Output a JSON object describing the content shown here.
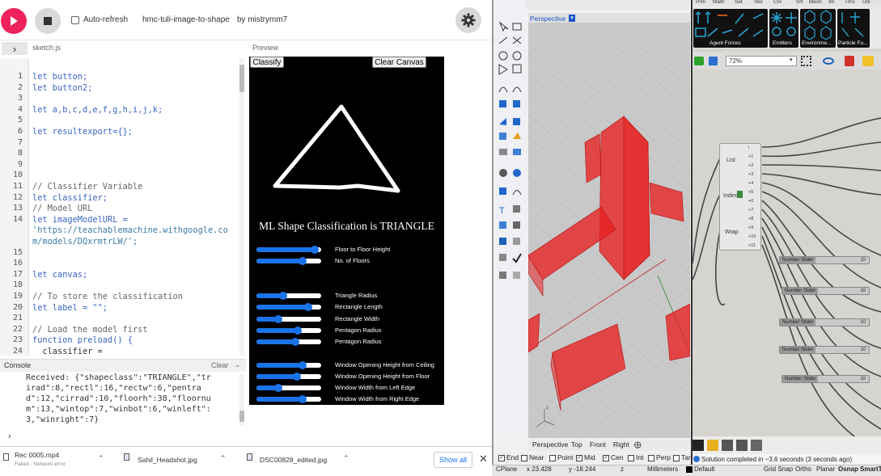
{
  "editor": {
    "auto_refresh_label": "Auto-refresh",
    "sketch_name": "hmc-tuli-image-to-shape",
    "by_label": "by mistrymm7",
    "file_name": "sketch.js",
    "preview_label": "Preview",
    "code_lines": [
      {
        "n": "1",
        "text": "let button;"
      },
      {
        "n": "2",
        "text": "let button2;"
      },
      {
        "n": "3",
        "text": ""
      },
      {
        "n": "4",
        "text": "let a,b,c,d,e,f,g,h,i,j,k;"
      },
      {
        "n": "5",
        "text": ""
      },
      {
        "n": "6",
        "text": "let resultexport={};"
      },
      {
        "n": "7",
        "text": ""
      },
      {
        "n": "8",
        "text": ""
      },
      {
        "n": "9",
        "text": ""
      },
      {
        "n": "10",
        "text": ""
      },
      {
        "n": "11",
        "text": "// Classifier Variable"
      },
      {
        "n": "12",
        "text": "let classifier;"
      },
      {
        "n": "13",
        "text": "// Model URL"
      },
      {
        "n": "14",
        "text": "let imageModelURL ="
      },
      {
        "n": "",
        "text": "'https://teachablemachine.withgoogle.co"
      },
      {
        "n": "",
        "text": "m/models/DQxrmtrLW/';"
      },
      {
        "n": "15",
        "text": ""
      },
      {
        "n": "16",
        "text": ""
      },
      {
        "n": "17",
        "text": "let canvas;"
      },
      {
        "n": "18",
        "text": ""
      },
      {
        "n": "19",
        "text": "// To store the classification"
      },
      {
        "n": "20",
        "text": "let label = \"\";"
      },
      {
        "n": "21",
        "text": ""
      },
      {
        "n": "22",
        "text": "// Load the model first"
      },
      {
        "n": "23",
        "text": "function preload() {"
      },
      {
        "n": "24",
        "text": "  classifier ="
      }
    ],
    "console_label": "Console",
    "clear_label": "Clear",
    "console_lines": [
      "Received: {\"shapeclass\":\"TRIANGLE\",\"tr",
      "irad\":8,\"rectl\":16,\"rectw\":6,\"pentra",
      "d\":12,\"cirrad\":10,\"floorh\":38,\"floornu",
      "m\":13,\"wintop\":7,\"winbot\":6,\"winleft\":",
      "3,\"winright\":7}"
    ],
    "prompt": "›"
  },
  "preview": {
    "classify_label": "Classify",
    "clear_canvas_label": "Clear Canvas",
    "result_text": "ML Shape Classification is TRIANGLE",
    "sliders": [
      {
        "label": "Floor to Floor Height",
        "value": 0.9
      },
      {
        "label": "No. of Floors",
        "value": 0.71
      },
      {
        "label": "Triangle Radius",
        "value": 0.41
      },
      {
        "label": "Rectangle Length",
        "value": 0.8
      },
      {
        "label": "Rectangle Width",
        "value": 0.34
      },
      {
        "label": "Pentagon Radius",
        "value": 0.64
      },
      {
        "label": "Pentagon Radius",
        "value": 0.6
      },
      {
        "label": "Window Opening Height from Ceiling",
        "value": 0.71
      },
      {
        "label": "Window Opening Height from Floor",
        "value": 0.63
      },
      {
        "label": "Window Width from Left Edge",
        "value": 0.34
      },
      {
        "label": "Window Width from Right Edge",
        "value": 0.71
      }
    ]
  },
  "downloads": {
    "items": [
      {
        "name": "Rec 0005.mp4",
        "sub": "Failed - Network error"
      },
      {
        "name": "Sahil_Headshot.jpg",
        "sub": ""
      },
      {
        "name": "DSC00828_edited.jpg",
        "sub": ""
      }
    ],
    "show_all": "Show all"
  },
  "rhino": {
    "viewport_title": "Perspective",
    "view_tabs": [
      "Perspective",
      "Top",
      "Front",
      "Right"
    ],
    "osnaps": [
      "End",
      "Near",
      "Point",
      "Mid",
      "Cen",
      "Int",
      "Perp",
      "Tan"
    ],
    "status": {
      "cplane": "CPlane",
      "x": "x 23.428",
      "y": "y -18.244",
      "z": "z",
      "units": "Millimeters",
      "layer": "Default",
      "toggles": [
        "Grid Snap",
        "Ortho",
        "Planar",
        "Osnap",
        "SmartT"
      ]
    }
  },
  "grasshopper": {
    "tabs": [
      "Prm",
      "Math",
      "Set",
      "Vec",
      "Crv",
      "Srf",
      "Mesh",
      "Int",
      "Trns",
      "Util"
    ],
    "panels": [
      "Agent Forces",
      "Emitters",
      "Environme...",
      "Particle Fu..."
    ],
    "zoom": "72%",
    "list_node": {
      "list": "List",
      "index": "Index",
      "wrap": "Wrap"
    },
    "outputs": [
      "i",
      "+1",
      "+2",
      "+3",
      "+4",
      "+5",
      "+6",
      "+7",
      "+8",
      "+9",
      "+10",
      "+11"
    ],
    "sliders": [
      {
        "name": "Number Slider",
        "value": "10"
      },
      {
        "name": "Number Slider",
        "value": "10"
      },
      {
        "name": "Number Slider",
        "value": "10"
      },
      {
        "name": "Number Slider",
        "value": "10"
      },
      {
        "name": "Number Slider",
        "value": "10"
      }
    ],
    "solution": "Solution completed in ~3.6 seconds (3 seconds ago)"
  },
  "colors": {
    "accent": "#ed225d",
    "slider": "#1a73e8",
    "extrusion": "#e82020"
  }
}
